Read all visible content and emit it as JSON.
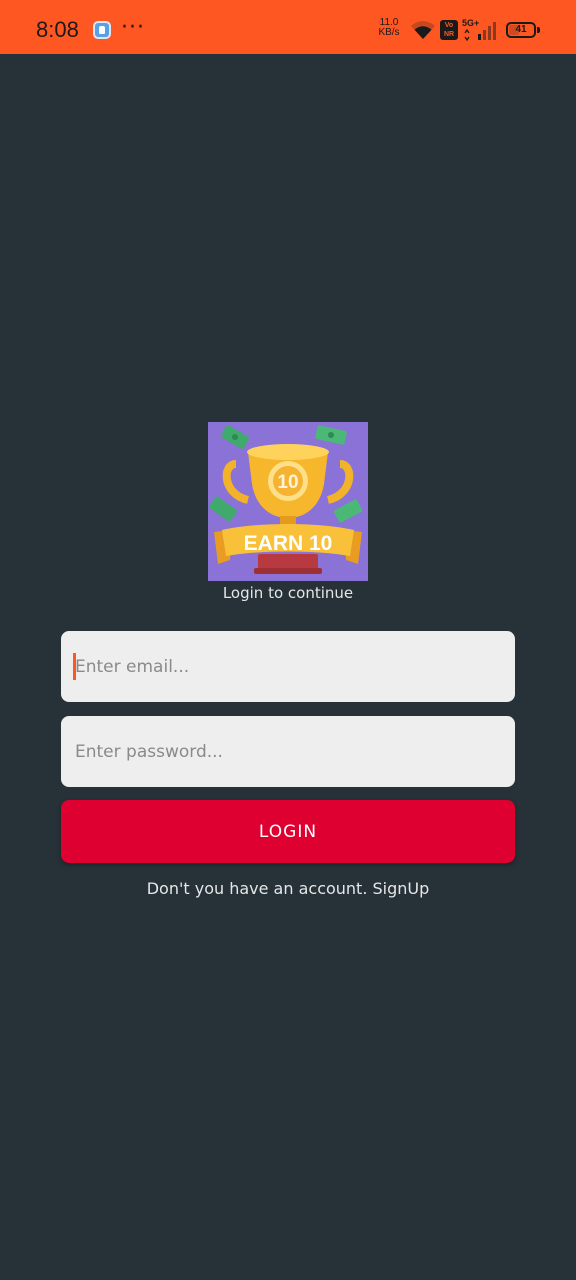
{
  "status_bar": {
    "time": "8:08",
    "more": "···",
    "net_speed_value": "11.0",
    "net_speed_unit": "KB/s",
    "volte_label": "Vo\nNR",
    "network_label": "5G+",
    "battery_level": "41",
    "battery_fraction": 0.41,
    "bar_color": "#FF5722"
  },
  "logo": {
    "text": "EARN 10",
    "coin_text": "10",
    "background": "#8A72D6",
    "icon": "trophy-icon"
  },
  "login": {
    "subtitle": "Login to continue",
    "email_placeholder": "Enter email...",
    "password_placeholder": "Enter password...",
    "button_label": "LOGIN",
    "button_color": "#DE0030",
    "background": "#263238"
  },
  "signup": {
    "prompt": "Don't you have an account.",
    "link": "SignUp"
  }
}
